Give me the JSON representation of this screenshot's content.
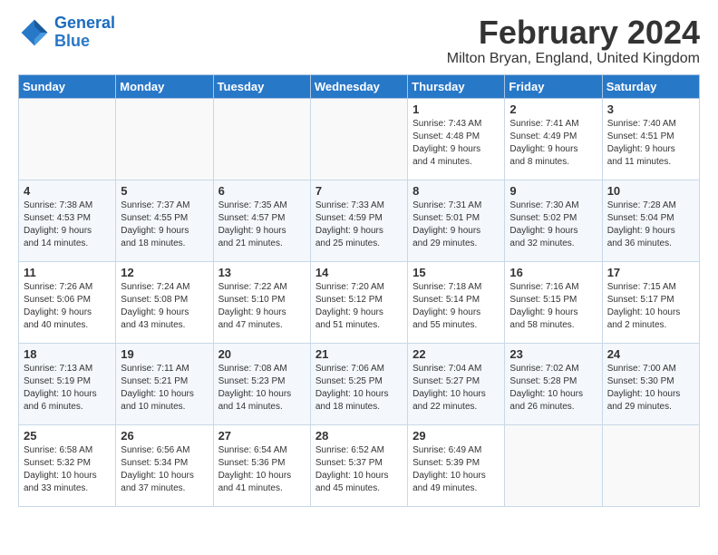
{
  "logo": {
    "line1": "General",
    "line2": "Blue"
  },
  "title": "February 2024",
  "location": "Milton Bryan, England, United Kingdom",
  "days_of_week": [
    "Sunday",
    "Monday",
    "Tuesday",
    "Wednesday",
    "Thursday",
    "Friday",
    "Saturday"
  ],
  "weeks": [
    [
      {
        "day": "",
        "info": ""
      },
      {
        "day": "",
        "info": ""
      },
      {
        "day": "",
        "info": ""
      },
      {
        "day": "",
        "info": ""
      },
      {
        "day": "1",
        "info": "Sunrise: 7:43 AM\nSunset: 4:48 PM\nDaylight: 9 hours\nand 4 minutes."
      },
      {
        "day": "2",
        "info": "Sunrise: 7:41 AM\nSunset: 4:49 PM\nDaylight: 9 hours\nand 8 minutes."
      },
      {
        "day": "3",
        "info": "Sunrise: 7:40 AM\nSunset: 4:51 PM\nDaylight: 9 hours\nand 11 minutes."
      }
    ],
    [
      {
        "day": "4",
        "info": "Sunrise: 7:38 AM\nSunset: 4:53 PM\nDaylight: 9 hours\nand 14 minutes."
      },
      {
        "day": "5",
        "info": "Sunrise: 7:37 AM\nSunset: 4:55 PM\nDaylight: 9 hours\nand 18 minutes."
      },
      {
        "day": "6",
        "info": "Sunrise: 7:35 AM\nSunset: 4:57 PM\nDaylight: 9 hours\nand 21 minutes."
      },
      {
        "day": "7",
        "info": "Sunrise: 7:33 AM\nSunset: 4:59 PM\nDaylight: 9 hours\nand 25 minutes."
      },
      {
        "day": "8",
        "info": "Sunrise: 7:31 AM\nSunset: 5:01 PM\nDaylight: 9 hours\nand 29 minutes."
      },
      {
        "day": "9",
        "info": "Sunrise: 7:30 AM\nSunset: 5:02 PM\nDaylight: 9 hours\nand 32 minutes."
      },
      {
        "day": "10",
        "info": "Sunrise: 7:28 AM\nSunset: 5:04 PM\nDaylight: 9 hours\nand 36 minutes."
      }
    ],
    [
      {
        "day": "11",
        "info": "Sunrise: 7:26 AM\nSunset: 5:06 PM\nDaylight: 9 hours\nand 40 minutes."
      },
      {
        "day": "12",
        "info": "Sunrise: 7:24 AM\nSunset: 5:08 PM\nDaylight: 9 hours\nand 43 minutes."
      },
      {
        "day": "13",
        "info": "Sunrise: 7:22 AM\nSunset: 5:10 PM\nDaylight: 9 hours\nand 47 minutes."
      },
      {
        "day": "14",
        "info": "Sunrise: 7:20 AM\nSunset: 5:12 PM\nDaylight: 9 hours\nand 51 minutes."
      },
      {
        "day": "15",
        "info": "Sunrise: 7:18 AM\nSunset: 5:14 PM\nDaylight: 9 hours\nand 55 minutes."
      },
      {
        "day": "16",
        "info": "Sunrise: 7:16 AM\nSunset: 5:15 PM\nDaylight: 9 hours\nand 58 minutes."
      },
      {
        "day": "17",
        "info": "Sunrise: 7:15 AM\nSunset: 5:17 PM\nDaylight: 10 hours\nand 2 minutes."
      }
    ],
    [
      {
        "day": "18",
        "info": "Sunrise: 7:13 AM\nSunset: 5:19 PM\nDaylight: 10 hours\nand 6 minutes."
      },
      {
        "day": "19",
        "info": "Sunrise: 7:11 AM\nSunset: 5:21 PM\nDaylight: 10 hours\nand 10 minutes."
      },
      {
        "day": "20",
        "info": "Sunrise: 7:08 AM\nSunset: 5:23 PM\nDaylight: 10 hours\nand 14 minutes."
      },
      {
        "day": "21",
        "info": "Sunrise: 7:06 AM\nSunset: 5:25 PM\nDaylight: 10 hours\nand 18 minutes."
      },
      {
        "day": "22",
        "info": "Sunrise: 7:04 AM\nSunset: 5:27 PM\nDaylight: 10 hours\nand 22 minutes."
      },
      {
        "day": "23",
        "info": "Sunrise: 7:02 AM\nSunset: 5:28 PM\nDaylight: 10 hours\nand 26 minutes."
      },
      {
        "day": "24",
        "info": "Sunrise: 7:00 AM\nSunset: 5:30 PM\nDaylight: 10 hours\nand 29 minutes."
      }
    ],
    [
      {
        "day": "25",
        "info": "Sunrise: 6:58 AM\nSunset: 5:32 PM\nDaylight: 10 hours\nand 33 minutes."
      },
      {
        "day": "26",
        "info": "Sunrise: 6:56 AM\nSunset: 5:34 PM\nDaylight: 10 hours\nand 37 minutes."
      },
      {
        "day": "27",
        "info": "Sunrise: 6:54 AM\nSunset: 5:36 PM\nDaylight: 10 hours\nand 41 minutes."
      },
      {
        "day": "28",
        "info": "Sunrise: 6:52 AM\nSunset: 5:37 PM\nDaylight: 10 hours\nand 45 minutes."
      },
      {
        "day": "29",
        "info": "Sunrise: 6:49 AM\nSunset: 5:39 PM\nDaylight: 10 hours\nand 49 minutes."
      },
      {
        "day": "",
        "info": ""
      },
      {
        "day": "",
        "info": ""
      }
    ]
  ]
}
